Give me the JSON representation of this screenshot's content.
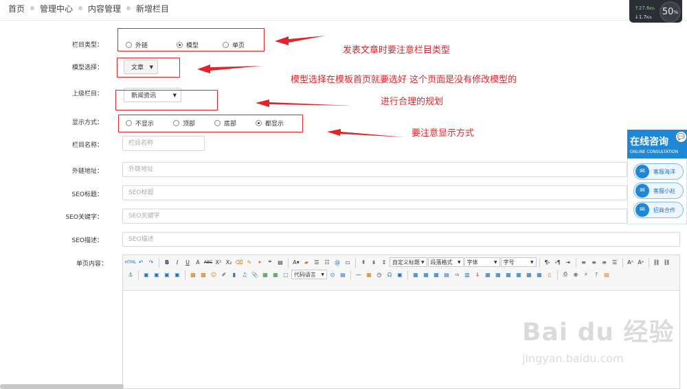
{
  "breadcrumb": [
    "首页",
    "管理中心",
    "内容管理",
    "新增栏目"
  ],
  "form": {
    "column_type": {
      "label": "栏目类型：",
      "options": [
        "外链",
        "模型",
        "单页"
      ],
      "selected": "模型"
    },
    "model_select": {
      "label": "模型选择：",
      "value": "文章"
    },
    "parent_column": {
      "label": "上级栏目：",
      "value": "新闻资讯"
    },
    "display_mode": {
      "label": "显示方式：",
      "options": [
        "不显示",
        "顶部",
        "底部",
        "都显示"
      ],
      "selected": "都显示"
    },
    "column_name": {
      "label": "栏目名称：",
      "placeholder": "栏目名称"
    },
    "external_url": {
      "label": "外链地址：",
      "placeholder": "外链地址"
    },
    "seo_title": {
      "label": "SEO标题：",
      "placeholder": "SEO标题"
    },
    "seo_keywords": {
      "label": "SEO关键字：",
      "placeholder": "SEO关键字"
    },
    "seo_description": {
      "label": "SEO描述：",
      "placeholder": "SEO描述"
    },
    "page_content": {
      "label": "单页内容："
    }
  },
  "editor_toolbar": {
    "custom_title": "自定义标题",
    "paragraph_format": "段落格式",
    "font_family": "字体",
    "font_size": "字号",
    "code_language": "代码语言"
  },
  "annotations": {
    "note1": "发表文章时要注意栏目类型",
    "note2": "模型选择在模板首页就要选好 这个页面是没有修改模型的",
    "note3": "进行合理的规划",
    "note4": "要注意显示方式",
    "color": "#e0242a"
  },
  "speed_meter": {
    "up": "27.6",
    "up_unit": "K/s",
    "down": "1.7",
    "down_unit": "K/s",
    "percent": "50",
    "percent_unit": "%"
  },
  "consult": {
    "title": "在线咨询",
    "subtitle": "ONLINE CONSULTATION",
    "buttons": [
      "客服海洋",
      "客服小赵",
      "招商合作"
    ]
  },
  "watermark": {
    "main": "Bai du 经验",
    "sub": "jingyan.baidu.com"
  }
}
